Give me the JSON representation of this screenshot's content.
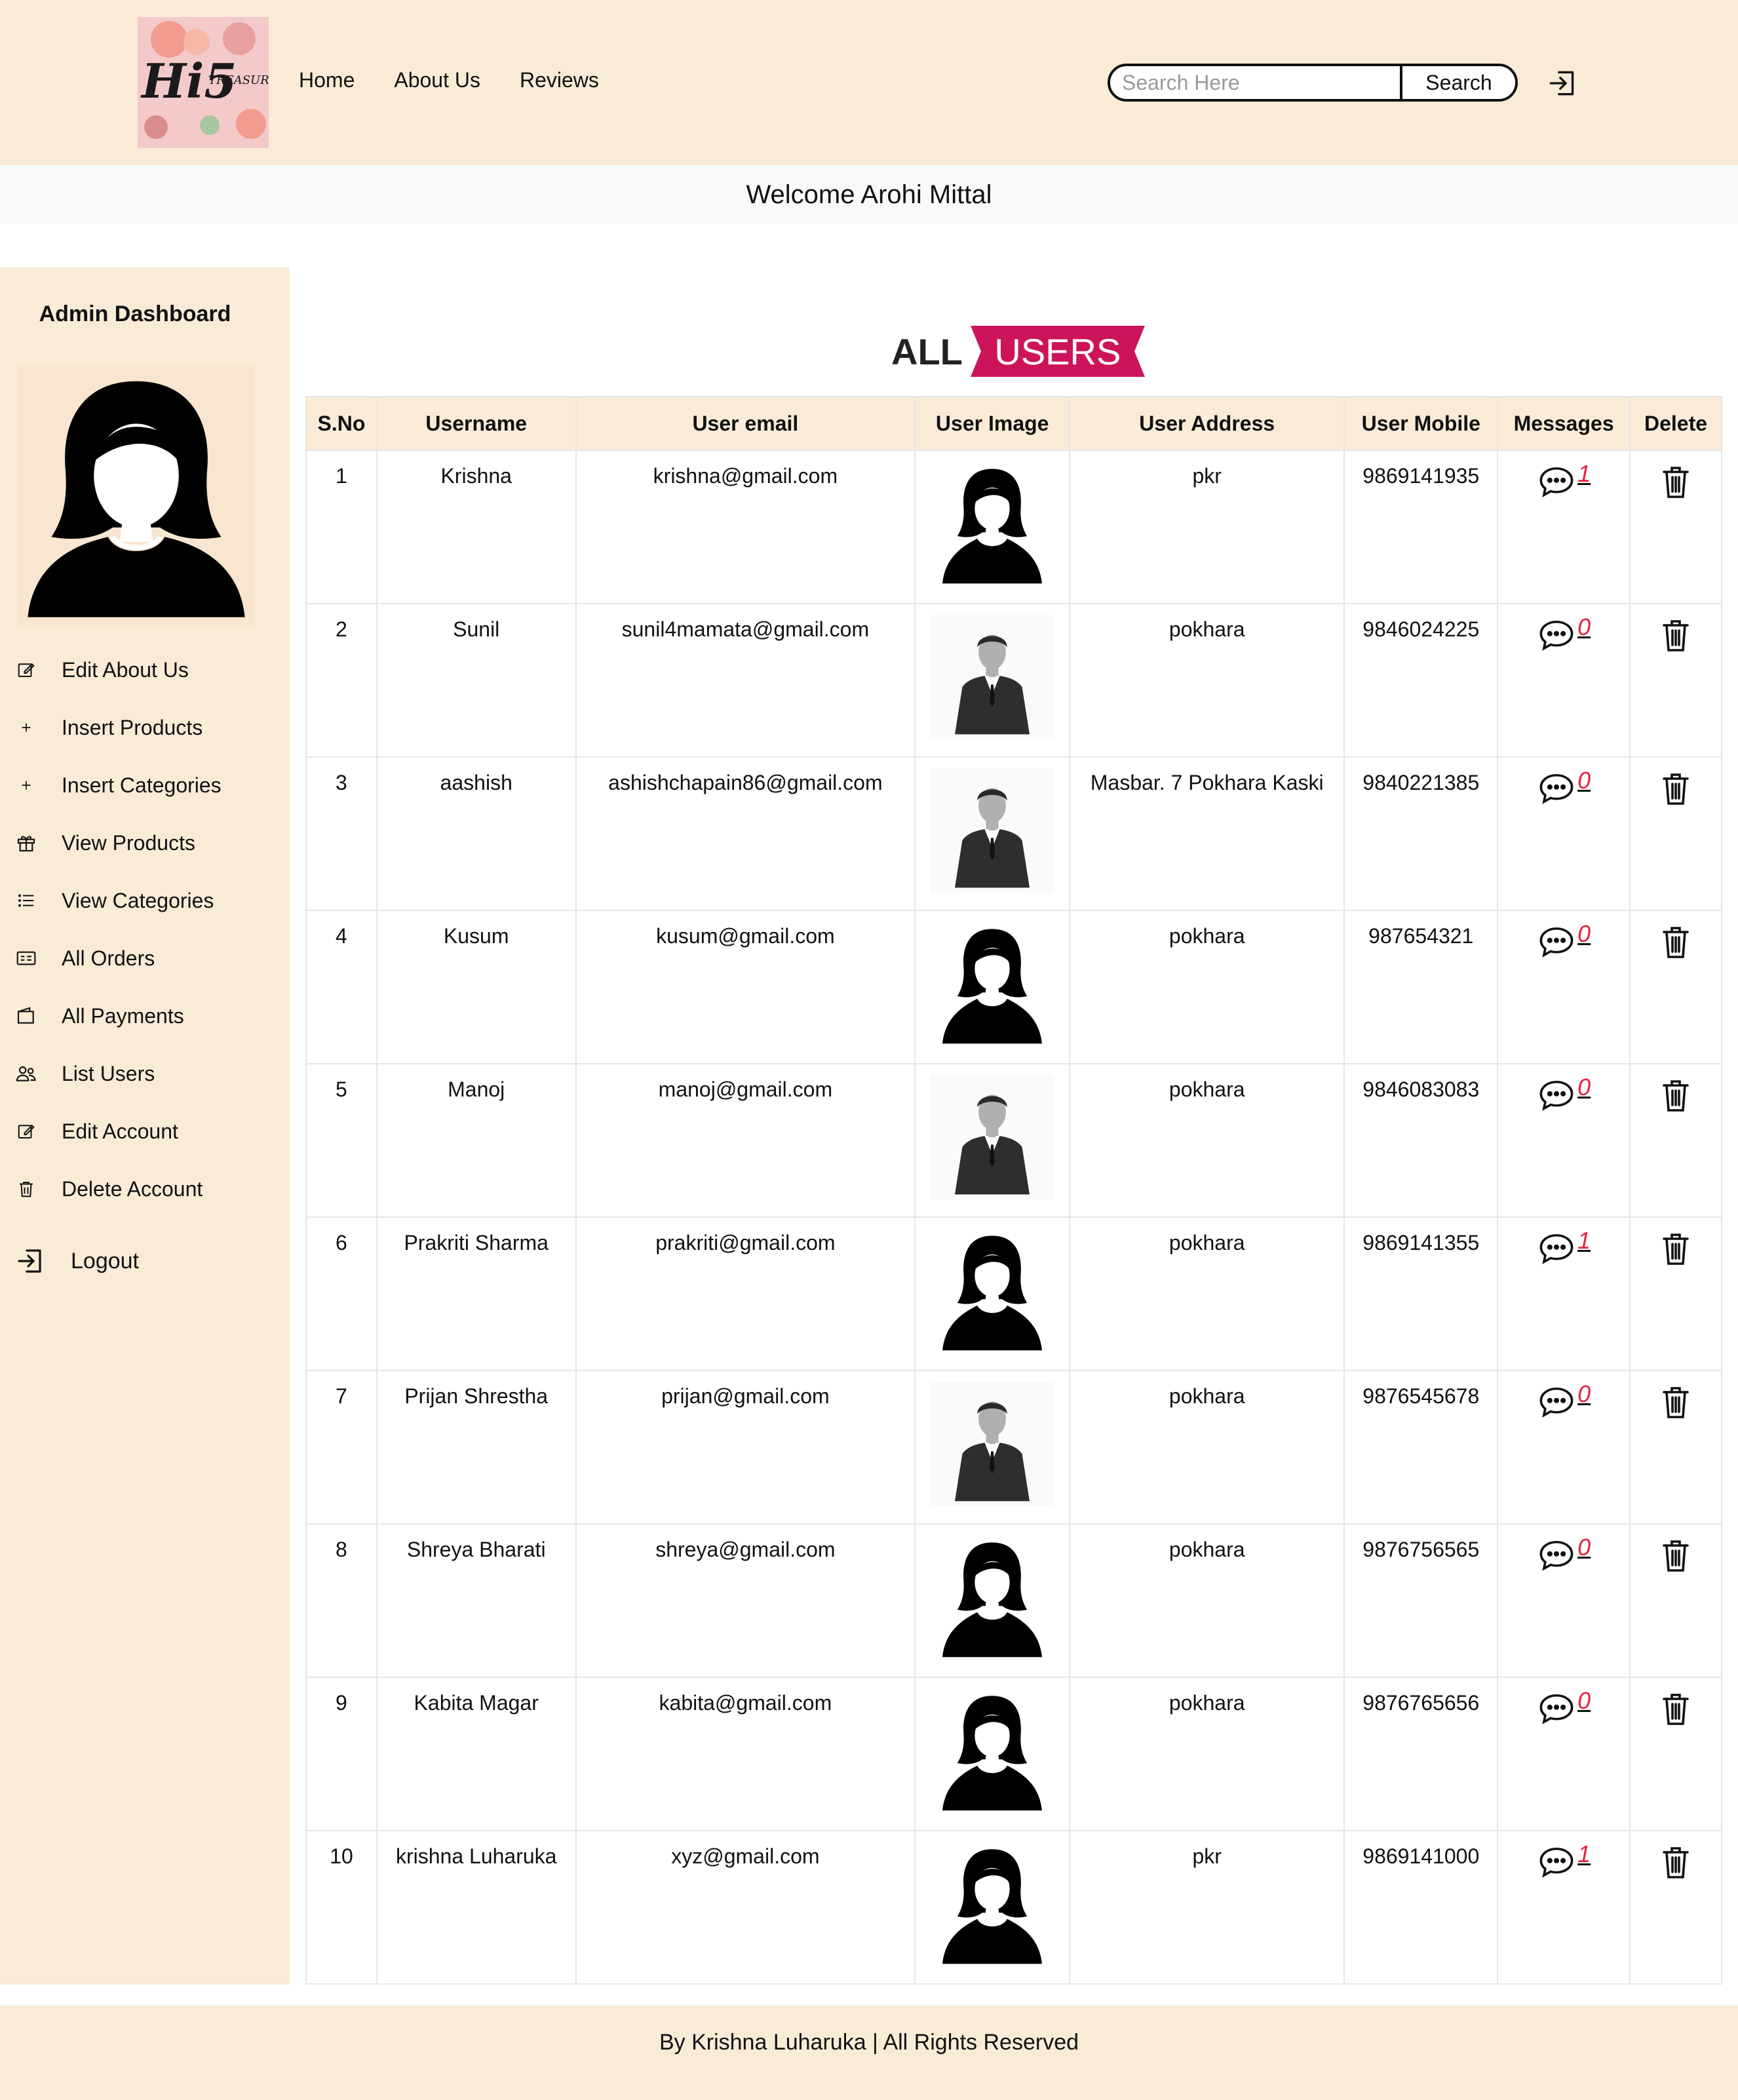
{
  "brand": {
    "logo_text": "Hi5",
    "logo_sub": "TREASURES",
    "colors": {
      "header_bg": "#faebd7",
      "accent": "#cc145b",
      "message_count": "#e8203f"
    }
  },
  "nav": {
    "items": [
      "Home",
      "About Us",
      "Reviews"
    ]
  },
  "search": {
    "placeholder": "Search Here",
    "button_label": "Search"
  },
  "welcome": "Welcome Arohi Mittal",
  "sidebar": {
    "title": "Admin Dashboard",
    "items": [
      {
        "label": "Edit About Us",
        "icon": "edit-icon"
      },
      {
        "label": "Insert Products",
        "icon": "plus-icon"
      },
      {
        "label": "Insert Categories",
        "icon": "plus-icon"
      },
      {
        "label": "View Products",
        "icon": "gift-icon"
      },
      {
        "label": "View Categories",
        "icon": "list-icon"
      },
      {
        "label": "All Orders",
        "icon": "orders-icon"
      },
      {
        "label": "All Payments",
        "icon": "wallet-icon"
      },
      {
        "label": "List Users",
        "icon": "users-icon"
      },
      {
        "label": "Edit Account",
        "icon": "edit-icon"
      },
      {
        "label": "Delete Account",
        "icon": "trash-icon"
      }
    ],
    "logout": "Logout"
  },
  "page_title": {
    "prefix": "ALL",
    "highlight": "USERS"
  },
  "table": {
    "headers": [
      "S.No",
      "Username",
      "User email",
      "User Image",
      "User Address",
      "User Mobile",
      "Messages",
      "Delete"
    ],
    "rows": [
      {
        "sno": "1",
        "username": "Krishna",
        "email": "krishna@gmail.com",
        "image": "female-avatar",
        "address": "pkr",
        "mobile": "9869141935",
        "messages": "1"
      },
      {
        "sno": "2",
        "username": "Sunil",
        "email": "sunil4mamata@gmail.com",
        "image": "male-avatar",
        "address": "pokhara",
        "mobile": "9846024225",
        "messages": "0"
      },
      {
        "sno": "3",
        "username": "aashish",
        "email": "ashishchapain86@gmail.com",
        "image": "male-avatar",
        "address": "Masbar. 7 Pokhara Kaski",
        "mobile": "9840221385",
        "messages": "0"
      },
      {
        "sno": "4",
        "username": "Kusum",
        "email": "kusum@gmail.com",
        "image": "female-avatar",
        "address": "pokhara",
        "mobile": "987654321",
        "messages": "0"
      },
      {
        "sno": "5",
        "username": "Manoj",
        "email": "manoj@gmail.com",
        "image": "male-avatar",
        "address": "pokhara",
        "mobile": "9846083083",
        "messages": "0"
      },
      {
        "sno": "6",
        "username": "Prakriti Sharma",
        "email": "prakriti@gmail.com",
        "image": "female-avatar",
        "address": "pokhara",
        "mobile": "9869141355",
        "messages": "1"
      },
      {
        "sno": "7",
        "username": "Prijan Shrestha",
        "email": "prijan@gmail.com",
        "image": "male-avatar",
        "address": "pokhara",
        "mobile": "9876545678",
        "messages": "0"
      },
      {
        "sno": "8",
        "username": "Shreya Bharati",
        "email": "shreya@gmail.com",
        "image": "female-avatar",
        "address": "pokhara",
        "mobile": "9876756565",
        "messages": "0"
      },
      {
        "sno": "9",
        "username": "Kabita Magar",
        "email": "kabita@gmail.com",
        "image": "female-avatar",
        "address": "pokhara",
        "mobile": "9876765656",
        "messages": "0"
      },
      {
        "sno": "10",
        "username": "krishna Luharuka",
        "email": "xyz@gmail.com",
        "image": "female-avatar",
        "address": "pkr",
        "mobile": "9869141000",
        "messages": "1"
      }
    ]
  },
  "footer": "By Krishna Luharuka | All Rights Reserved"
}
